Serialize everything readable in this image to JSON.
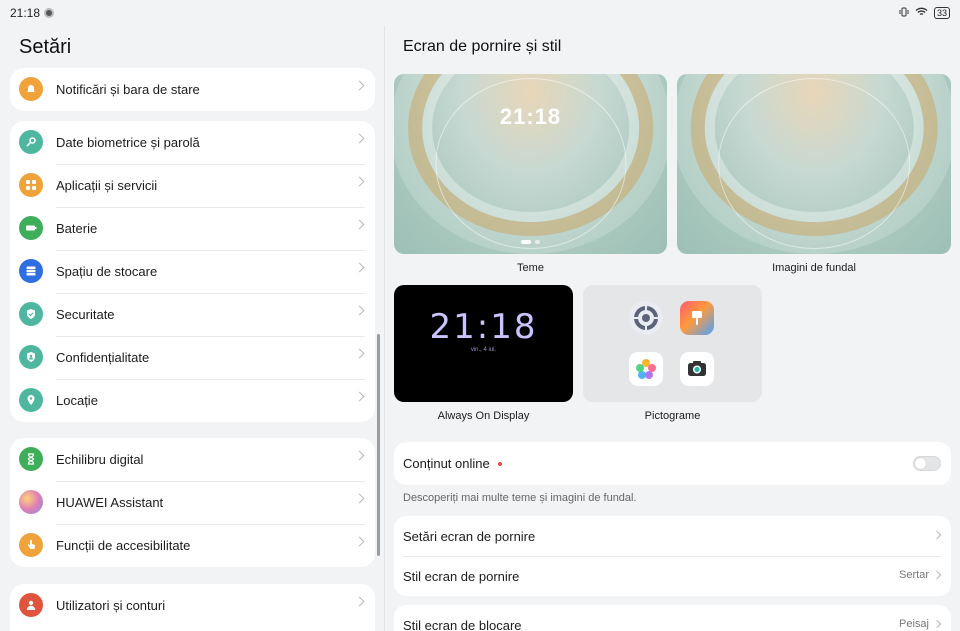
{
  "status": {
    "time": "21:18",
    "battery": "33"
  },
  "settings": {
    "title": "Setări",
    "groups": [
      [
        {
          "label": "Notificări și bara de stare",
          "icon": "bell-icon",
          "color": "#f0a33a"
        }
      ],
      [
        {
          "label": "Date biometrice și parolă",
          "icon": "key-icon",
          "color": "#4fb7a0"
        },
        {
          "label": "Aplicații și servicii",
          "icon": "apps-grid-icon",
          "color": "#f0a33a"
        },
        {
          "label": "Baterie",
          "icon": "battery-icon",
          "color": "#3fae5a"
        },
        {
          "label": "Spațiu de stocare",
          "icon": "storage-icon",
          "color": "#2f6ee0"
        },
        {
          "label": "Securitate",
          "icon": "shield-icon",
          "color": "#4fb7a0"
        },
        {
          "label": "Confidențialitate",
          "icon": "privacy-icon",
          "color": "#4fb7a0"
        },
        {
          "label": "Locație",
          "icon": "location-pin-icon",
          "color": "#4fb7a0"
        }
      ],
      [
        {
          "label": "Echilibru digital",
          "icon": "hourglass-icon",
          "color": "#3fae5a"
        },
        {
          "label": "HUAWEI Assistant",
          "icon": "assistant-orb-icon",
          "color": "#c58ad8"
        },
        {
          "label": "Funcții de accesibilitate",
          "icon": "hand-pointer-icon",
          "color": "#f0a33a"
        }
      ],
      [
        {
          "label": "Utilizatori și conturi",
          "icon": "user-icon",
          "color": "#e0533d"
        }
      ]
    ]
  },
  "main": {
    "title": "Ecran de pornire și stil",
    "thumbs": {
      "themes": "Teme",
      "themes_time": "21:18",
      "wallpapers": "Imagini de fundal",
      "aod": "Always On Display",
      "aod_time": "21:18",
      "aod_date": "vin., 4 iul.",
      "icons": "Pictograme"
    },
    "online_content": {
      "label": "Conținut online",
      "hint": "Descoperiți mai multe teme și imagini de fundal."
    },
    "home_settings": {
      "label": "Setări ecran de pornire"
    },
    "home_style": {
      "label": "Stil ecran de pornire",
      "value": "Sertar"
    },
    "lock_style": {
      "label": "Stil ecran de blocare",
      "value": "Peisaj"
    }
  }
}
